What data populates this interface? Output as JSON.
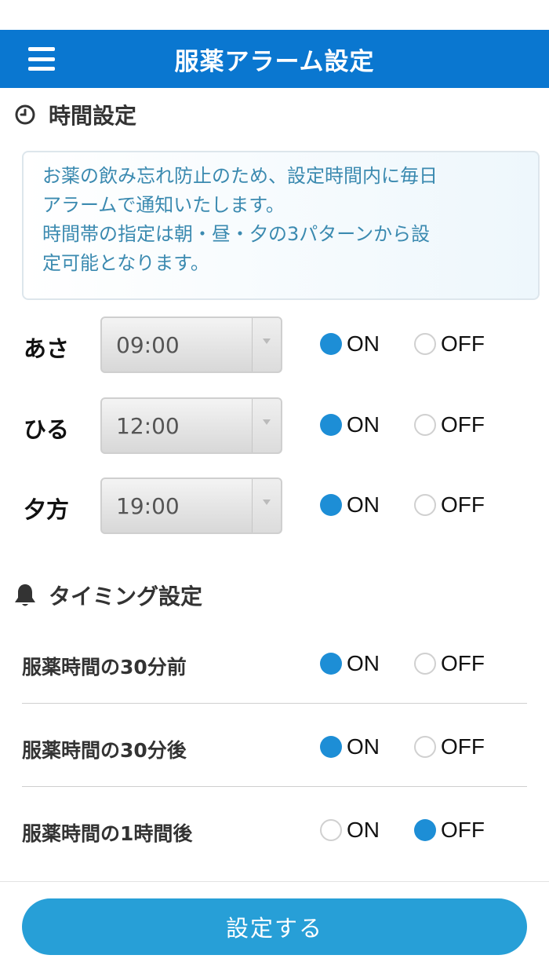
{
  "header": {
    "title": "服薬アラーム設定",
    "menu_icon": "hamburger-menu-icon",
    "background_color": "#0a77d0"
  },
  "time_section": {
    "title": "時間設定",
    "icon": "clock-icon",
    "notice_lines": [
      "お薬の飲み忘れ防止のため、設定時間内に毎日",
      "アラームで通知いたします。",
      "時間帯の指定は朝・昼・夕の3パターンから設",
      "定可能となります。"
    ],
    "rows": [
      {
        "label": "あさ",
        "time": "09:00",
        "on_label": "ON",
        "off_label": "OFF",
        "selected": "ON"
      },
      {
        "label": "ひる",
        "time": "12:00",
        "on_label": "ON",
        "off_label": "OFF",
        "selected": "ON"
      },
      {
        "label": "夕方",
        "time": "19:00",
        "on_label": "ON",
        "off_label": "OFF",
        "selected": "ON"
      }
    ]
  },
  "timing_section": {
    "title": "タイミング設定",
    "icon": "bell-icon",
    "rows": [
      {
        "label": "服薬時間の30分前",
        "on_label": "ON",
        "off_label": "OFF",
        "selected": "ON"
      },
      {
        "label": "服薬時間の30分後",
        "on_label": "ON",
        "off_label": "OFF",
        "selected": "ON"
      },
      {
        "label": "服薬時間の1時間後",
        "on_label": "ON",
        "off_label": "OFF",
        "selected": "OFF"
      }
    ]
  },
  "footer": {
    "submit_label": "設定する",
    "button_color": "#279fd7"
  }
}
